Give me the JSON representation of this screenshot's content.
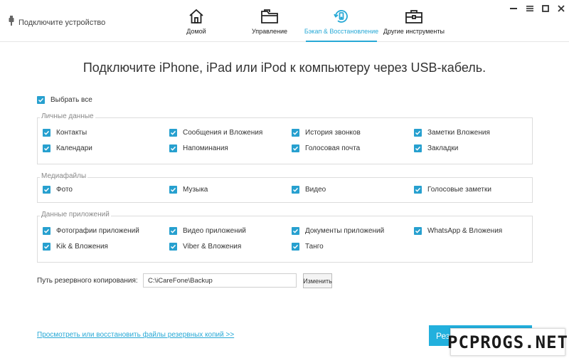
{
  "header": {
    "device_status": "Подключите устройство",
    "tabs": [
      {
        "label": "Домой",
        "icon": "home-icon"
      },
      {
        "label": "Управление",
        "icon": "folder-icon"
      },
      {
        "label": "Бэкап & Восстановление",
        "icon": "backup-restore-icon"
      },
      {
        "label": "Другие инструменты",
        "icon": "toolbox-icon"
      }
    ],
    "active_tab": "Бэкап & Восстановление",
    "accent_color": "#28a9d6"
  },
  "main": {
    "heading": "Подключите iPhone, iPad или iPod к компьютеру через USB-кабель.",
    "select_all": "Выбрать все",
    "groups": [
      {
        "title": "Личные данные",
        "items": [
          "Контакты",
          "Сообщения и Вложения",
          "История звонков",
          "Заметки Вложения",
          "Календари",
          "Напоминания",
          "Голосовая почта",
          "Закладки"
        ]
      },
      {
        "title": "Медиафайлы",
        "items": [
          "Фото",
          "Музыка",
          "Видео",
          "Голосовые заметки"
        ]
      },
      {
        "title": "Данные приложений",
        "items": [
          "Фотографии приложений",
          "Видео приложений",
          "Документы приложений",
          "WhatsApp & Вложения",
          "Kik & Вложения",
          "Viber & Вложения",
          "Танго"
        ]
      }
    ],
    "backup_path": {
      "label": "Путь резервного копирования:",
      "value": "C:\\iCareFone\\Backup",
      "change_button": "Изменить"
    },
    "view_link": "Просмотреть или восстановить файлы резервных копий >>",
    "backup_button": "Резе",
    "watermark": "PCPROGS.NET"
  }
}
